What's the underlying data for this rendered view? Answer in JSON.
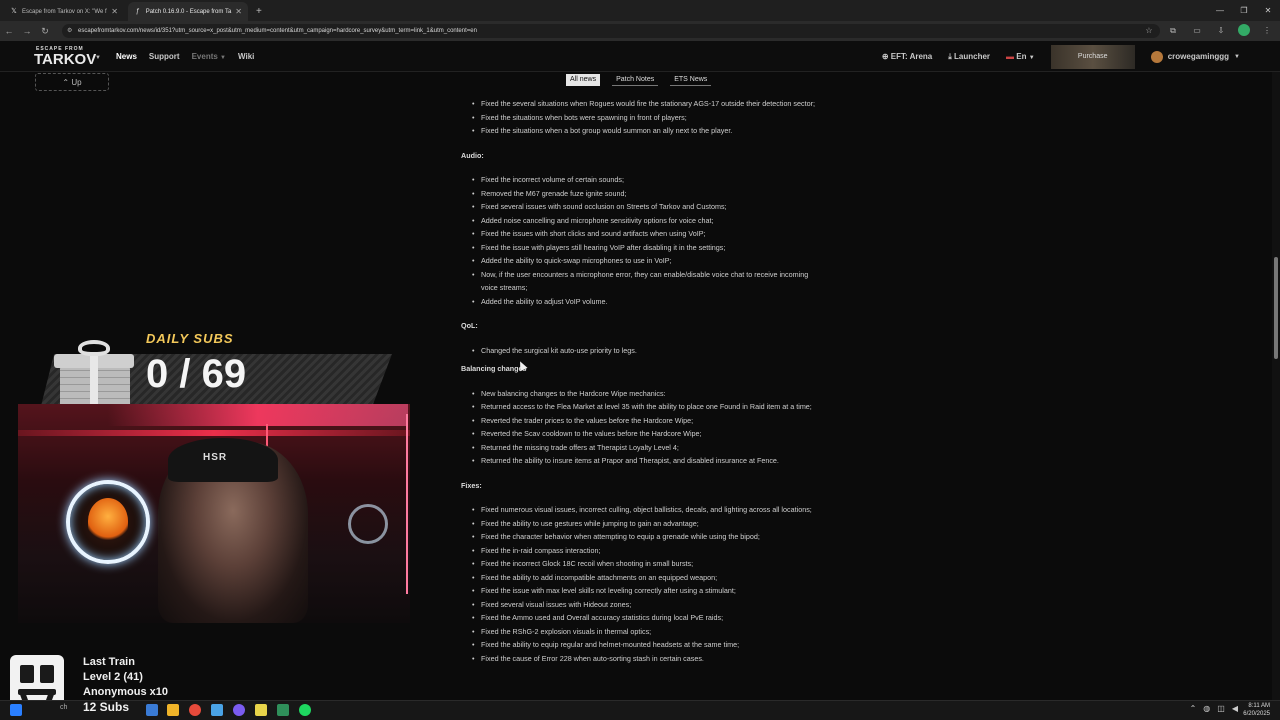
{
  "browser": {
    "tabs": [
      {
        "title": "Escape from Tarkov on X: \"We f",
        "icon": "x-logo-icon"
      },
      {
        "title": "Patch 0.16.9.0 - Escape from Ta",
        "icon": "tarkov-favicon-icon"
      }
    ],
    "new_tab": "+",
    "url": "escapefromtarkov.com/news/id/351?utm_source=x_post&utm_medium=content&utm_campaign=hardcore_survey&utm_term=link_1&utm_content=en"
  },
  "site": {
    "logo_small": "ESCAPE FROM",
    "logo_big": "TARKOV",
    "nav": [
      "News",
      "Support",
      "Events",
      "Wiki"
    ],
    "arena": "EFT: Arena",
    "launcher": "Launcher",
    "lang": "En",
    "purchase": "Purchase",
    "username": "crowegaminggg",
    "up_button": "Up",
    "subtabs": [
      "All news",
      "Patch Notes",
      "ETS News"
    ]
  },
  "content": {
    "top_items": [
      "Fixed the several situations when Rogues would fire the stationary AGS-17 outside their detection sector;",
      "Fixed the situations when bots were spawning in front of players;",
      "Fixed the situations when a bot group would summon an ally next to the player."
    ],
    "audio_title": "Audio:",
    "audio_items": [
      "Fixed the incorrect volume of certain sounds;",
      "Removed the M67 grenade fuze ignite sound;",
      "Fixed several issues with sound occlusion on Streets of Tarkov and Customs;",
      "Added noise cancelling and microphone sensitivity options for voice chat;",
      "Fixed the issues with short clicks and sound artifacts when using VoIP;",
      "Fixed the issue with players still hearing VoIP after disabling it in the settings;",
      "Added the ability to quick-swap microphones to use in VoIP;",
      "Now, if the user encounters a microphone error, they can enable/disable voice chat to receive incoming voice streams;",
      "Added the ability to adjust VoIP volume."
    ],
    "qol_title": "QoL:",
    "qol_items": [
      "Changed the surgical kit auto-use priority to legs."
    ],
    "balancing_title": "Balancing changes",
    "balancing_items": [
      "New balancing changes to the Hardcore Wipe mechanics:",
      "Returned access to the Flea Market at level 35 with the ability to place one Found in Raid item at a time;",
      "Reverted the trader prices to the values before the Hardcore Wipe;",
      "Reverted the Scav cooldown to the values before the Hardcore Wipe;",
      "Returned the missing trade offers at Therapist Loyalty Level 4;",
      "Returned the ability to insure items at Prapor and Therapist, and disabled insurance at Fence."
    ],
    "fixes_title": "Fixes:",
    "fixes_items": [
      "Fixed numerous visual issues, incorrect culling, object ballistics, decals, and lighting across all locations;",
      "Fixed the ability to use gestures while jumping to gain an advantage;",
      "Fixed the character behavior when attempting to equip a grenade while using the bipod;",
      "Fixed the in-raid compass interaction;",
      "Fixed the incorrect Glock 18C recoil when shooting in small bursts;",
      "Fixed the ability to add incompatible attachments on an equipped weapon;",
      "Fixed the issue with max level skills not leveling correctly after using a stimulant;",
      "Fixed several visual issues with Hideout zones;",
      "Fixed the Ammo used and Overall accuracy statistics during local PvE raids;",
      "Fixed the RShG-2 explosion visuals in thermal optics;",
      "Fixed the ability to equip regular and helmet-mounted headsets at the same time;",
      "Fixed the cause of Error 228 when auto-sorting stash in certain cases."
    ]
  },
  "overlay": {
    "daily_subs_label": "DAILY SUBS",
    "daily_subs_count": "0 / 69",
    "cap_text": "HSR",
    "train_name": "Last Train",
    "train_level": "Level 2  (41)",
    "train_anon": "Anonymous x10",
    "subs_badge": "12 Subs"
  },
  "taskbar": {
    "search": "ch",
    "time": "8:11 AM",
    "date": "6/20/2025"
  }
}
